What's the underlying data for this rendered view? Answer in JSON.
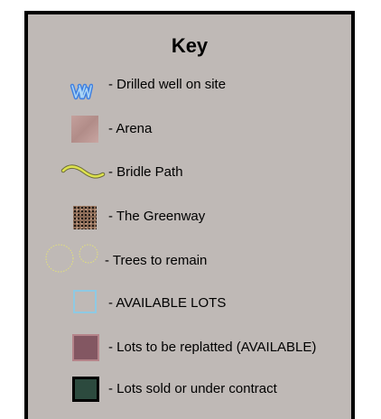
{
  "key": {
    "title": "Key",
    "items": [
      {
        "icon": "drilled-well-icon",
        "label": "- Drilled well on site",
        "color": "#3f7fe0"
      },
      {
        "icon": "arena-swatch-icon",
        "label": "- Arena",
        "color": "#bf9b97"
      },
      {
        "icon": "bridle-path-icon",
        "label": "- Bridle Path",
        "color": "#d8e04a"
      },
      {
        "icon": "greenway-swatch-icon",
        "label": "- The Greenway",
        "color": "#8a6a55"
      },
      {
        "icon": "trees-circles-icon",
        "label": "- Trees to remain",
        "color": "#e2e07a"
      },
      {
        "icon": "available-lot-swatch-icon",
        "label": "- AVAILABLE LOTS",
        "color": "#8ec9e3"
      },
      {
        "icon": "replat-lot-swatch-icon",
        "label": "- Lots to be replatted (AVAILABLE)",
        "color": "#835762"
      },
      {
        "icon": "sold-lot-swatch-icon",
        "label": "- Lots sold or under contract",
        "color": "#2c4a3e"
      }
    ]
  }
}
